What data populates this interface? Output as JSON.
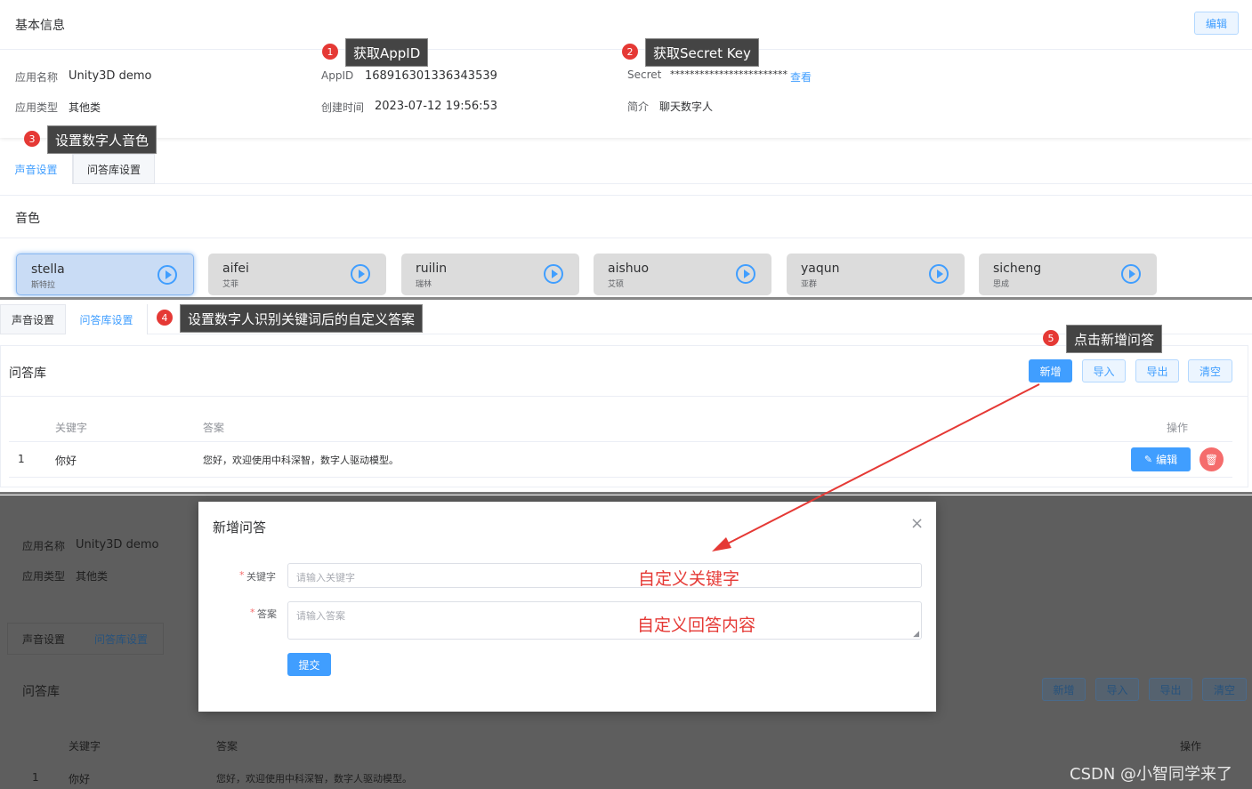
{
  "basic": {
    "title": "基本信息",
    "edit_label": "编辑",
    "app_name_label": "应用名称",
    "app_name": "Unity3D demo",
    "app_type_label": "应用类型",
    "app_type": "其他类",
    "appid_label": "AppID",
    "appid": "168916301336343539",
    "created_label": "创建时间",
    "created": "2023-07-12 19:56:53",
    "secret_label": "Secret",
    "secret": "************************",
    "view_label": "查看",
    "intro_label": "简介",
    "intro": "聊天数字人"
  },
  "annotations": [
    {
      "num": "1",
      "text": "获取AppID"
    },
    {
      "num": "2",
      "text": "获取Secret Key"
    },
    {
      "num": "3",
      "text": "设置数字人音色"
    },
    {
      "num": "4",
      "text": "设置数字人识别关键词后的自定义答案"
    },
    {
      "num": "5",
      "text": "点击新增问答"
    }
  ],
  "tabs": {
    "voice": "声音设置",
    "qa": "问答库设置"
  },
  "timbre": {
    "title": "音色",
    "voices": [
      {
        "name": "stella",
        "sub": "斯特拉"
      },
      {
        "name": "aifei",
        "sub": "艾菲"
      },
      {
        "name": "ruilin",
        "sub": "瑞林"
      },
      {
        "name": "aishuo",
        "sub": "艾硕"
      },
      {
        "name": "yaqun",
        "sub": "亚群"
      },
      {
        "name": "sicheng",
        "sub": "思成"
      }
    ]
  },
  "qa": {
    "title": "问答库",
    "buttons": {
      "add": "新增",
      "import": "导入",
      "export": "导出",
      "clear": "清空"
    },
    "columns": {
      "keyword": "关键字",
      "answer": "答案",
      "action": "操作"
    },
    "rows": [
      {
        "index": "1",
        "keyword": "你好",
        "answer": "您好，欢迎使用中科深智，数字人驱动模型。"
      }
    ],
    "row_edit": "编辑"
  },
  "modal": {
    "title": "新增问答",
    "close": "×",
    "keyword_label": "关键字",
    "keyword_placeholder": "请输入关键字",
    "answer_label": "答案",
    "answer_placeholder": "请输入答案",
    "submit": "提交",
    "keyword_note": "自定义关键字",
    "answer_note": "自定义回答内容"
  },
  "watermark": "CSDN @小智同学来了",
  "colors": {
    "primary": "#409eff",
    "danger": "#f56c6c",
    "annotation": "#e53935"
  }
}
